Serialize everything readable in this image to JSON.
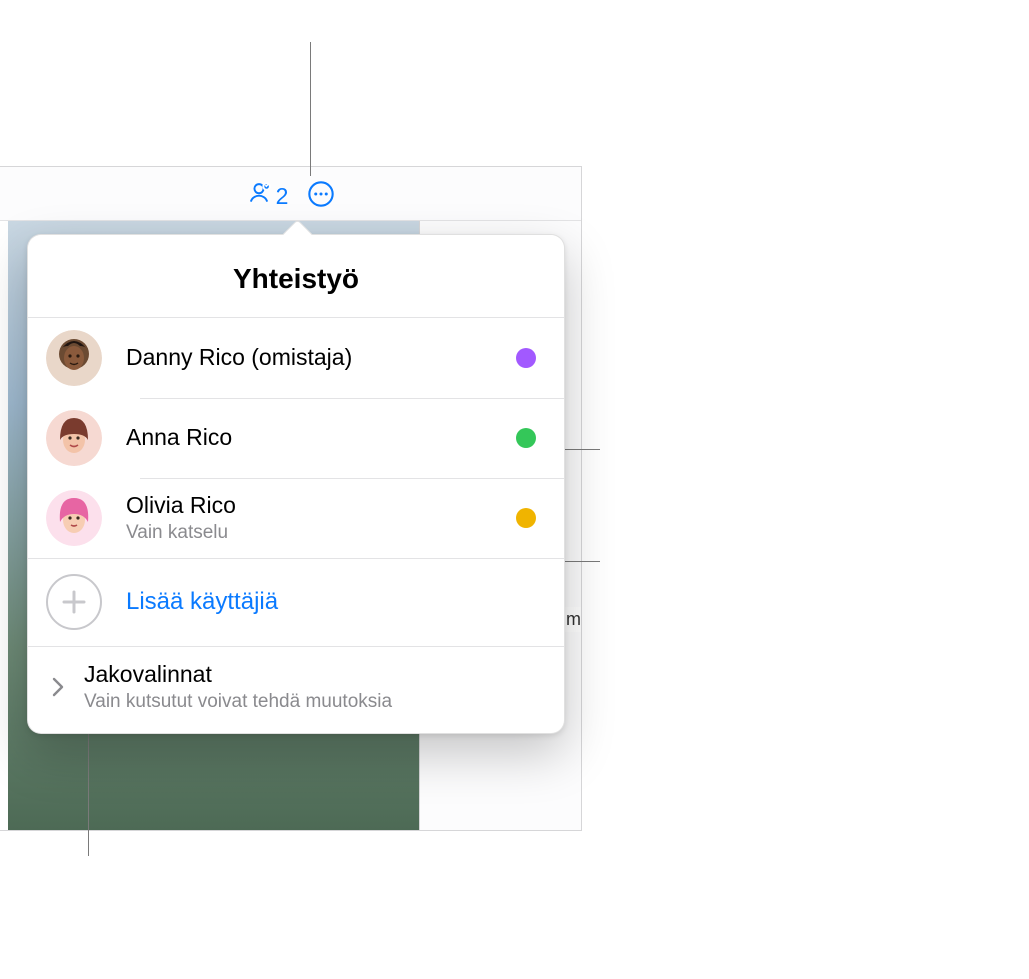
{
  "toolbar": {
    "collaborator_count": "2"
  },
  "backdrop": {
    "side_text_fragment": "um"
  },
  "popover": {
    "title": "Yhteistyö",
    "participants": [
      {
        "name": "Danny Rico (omistaja)",
        "sub": "",
        "dot_color": "#a259ff"
      },
      {
        "name": "Anna Rico",
        "sub": "",
        "dot_color": "#34c759"
      },
      {
        "name": "Olivia Rico",
        "sub": "Vain katselu",
        "dot_color": "#f0b400"
      }
    ],
    "add_label": "Lisää käyttäjiä",
    "options": {
      "title": "Jakovalinnat",
      "sub": "Vain kutsutut voivat tehdä muutoksia"
    }
  }
}
